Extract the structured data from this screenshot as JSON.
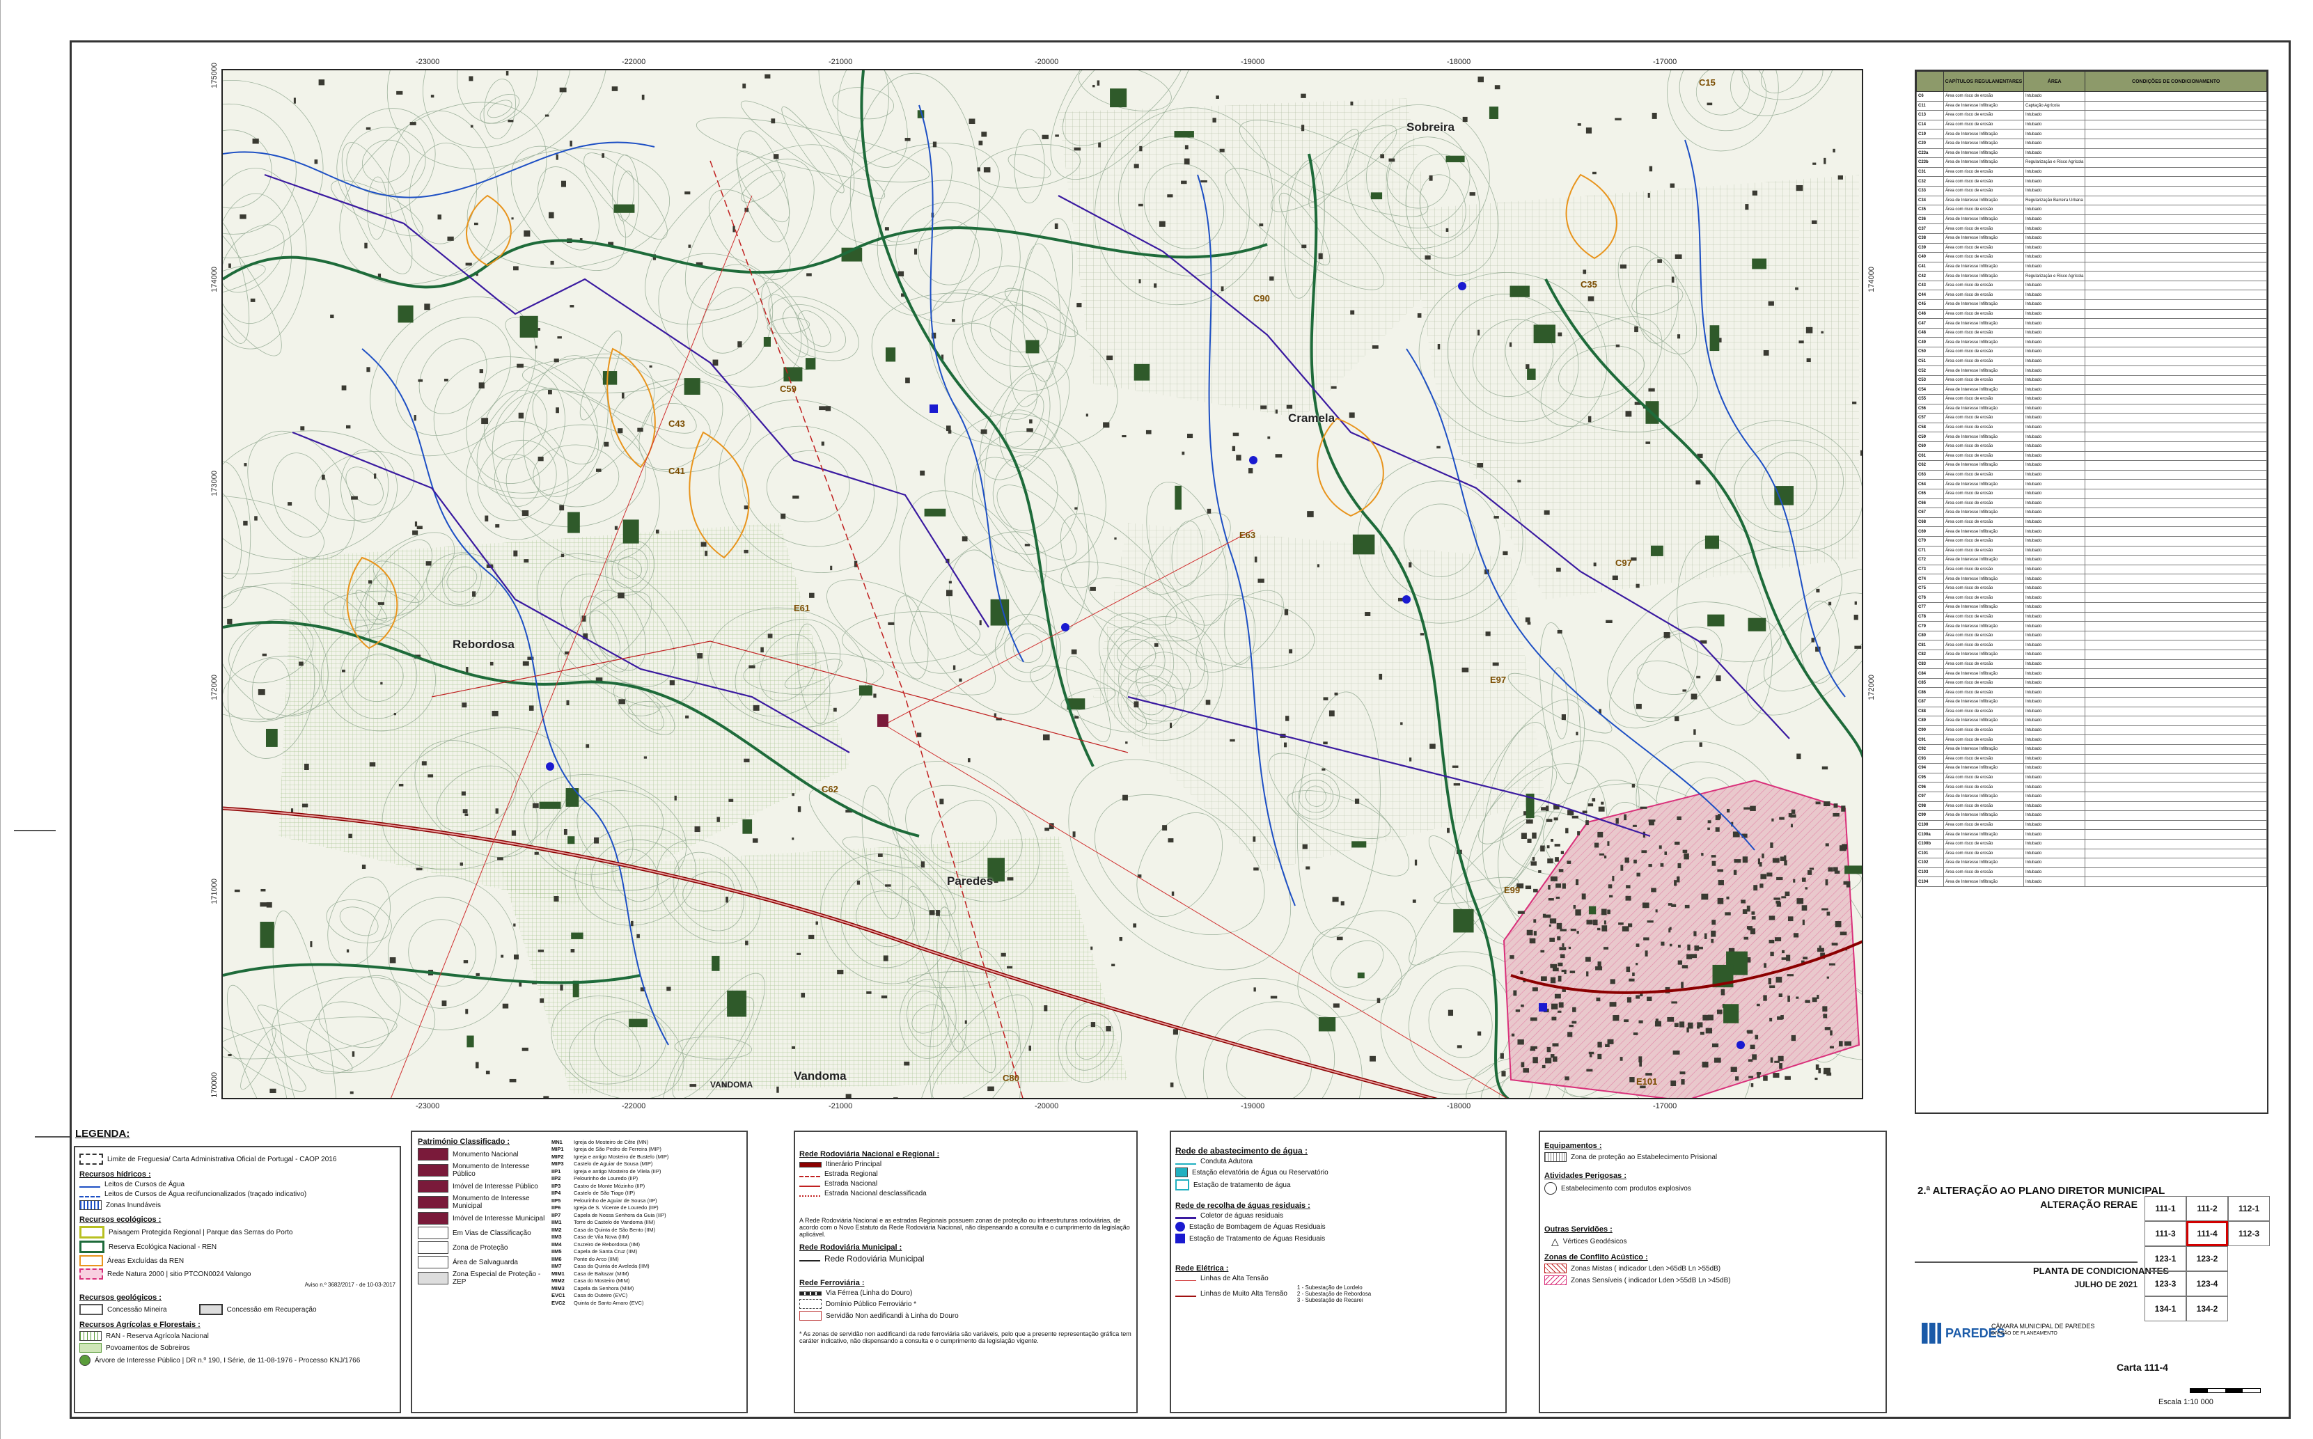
{
  "map": {
    "x_coords": [
      "-23000",
      "-22000",
      "-21000",
      "-20000",
      "-19000",
      "-18000",
      "-17000"
    ],
    "y_coords": [
      "175000",
      "174000",
      "173000",
      "172000",
      "171000",
      "170000"
    ],
    "places": [
      "Sobreira",
      "Cramela",
      "Rebordosa",
      "Paredes",
      "Vandoma"
    ],
    "features": [
      "VANDOMA",
      "C62",
      "C43",
      "C41",
      "C59",
      "E61",
      "E63",
      "E97",
      "E99",
      "E101",
      "C80",
      "C15",
      "C90",
      "C97",
      "C35"
    ]
  },
  "table": {
    "headers": [
      "",
      "CAPÍTULOS REGULAMENTARES",
      "ÁREA",
      "",
      "CONDIÇÕES DE CONDICIONAMENTO"
    ],
    "rows": [
      [
        "C6",
        "Área com risco de erosão",
        "Intubado"
      ],
      [
        "C11",
        "Área de Interesse Infiltração",
        "Captação Agrícola"
      ],
      [
        "C13",
        "Área com risco de erosão",
        "Intubado"
      ],
      [
        "C14",
        "Área com risco de erosão",
        "Intubado"
      ],
      [
        "C19",
        "Área de Interesse Infiltração",
        "Intubado"
      ],
      [
        "C20",
        "Área de Interesse Infiltração",
        "Intubado"
      ],
      [
        "C23a",
        "Área de Interesse Infiltração",
        "Intubado"
      ],
      [
        "C23b",
        "Área de Interesse Infiltração",
        "Regularização e Risco Agrícola"
      ],
      [
        "C31",
        "Área com risco de erosão",
        "Intubado"
      ],
      [
        "C32",
        "Área com risco de erosão",
        "Intubado"
      ],
      [
        "C33",
        "Área com risco de erosão",
        "Intubado"
      ],
      [
        "C34",
        "Área de Interesse Infiltração",
        "Regularização Barreira Urbana"
      ],
      [
        "C35",
        "Área com risco de erosão",
        "Intubado"
      ],
      [
        "C36",
        "Área de Interesse Infiltração",
        "Intubado"
      ],
      [
        "C37",
        "Área com risco de erosão",
        "Intubado"
      ],
      [
        "C38",
        "Área de Interesse Infiltração",
        "Intubado"
      ],
      [
        "C39",
        "Área com risco de erosão",
        "Intubado"
      ],
      [
        "C40",
        "Área com risco de erosão",
        "Intubado"
      ],
      [
        "C41",
        "Área de Interesse Infiltração",
        "Intubado"
      ],
      [
        "C42",
        "Área de Interesse Infiltração",
        "Regularização e Risco Agrícola"
      ],
      [
        "C43",
        "Área com risco de erosão",
        "Intubado"
      ],
      [
        "C44",
        "Área com risco de erosão",
        "Intubado"
      ],
      [
        "C45",
        "Área de Interesse Infiltração",
        "Intubado"
      ],
      [
        "C46",
        "Área com risco de erosão",
        "Intubado"
      ],
      [
        "C47",
        "Área de Interesse Infiltração",
        "Intubado"
      ],
      [
        "C48",
        "Área com risco de erosão",
        "Intubado"
      ],
      [
        "C49",
        "Área de Interesse Infiltração",
        "Intubado"
      ],
      [
        "C50",
        "Área com risco de erosão",
        "Intubado"
      ],
      [
        "C51",
        "Área com risco de erosão",
        "Intubado"
      ],
      [
        "C52",
        "Área de Interesse Infiltração",
        "Intubado"
      ],
      [
        "C53",
        "Área com risco de erosão",
        "Intubado"
      ],
      [
        "C54",
        "Área de Interesse Infiltração",
        "Intubado"
      ],
      [
        "C55",
        "Área com risco de erosão",
        "Intubado"
      ],
      [
        "C56",
        "Área de Interesse Infiltração",
        "Intubado"
      ],
      [
        "C57",
        "Área com risco de erosão",
        "Intubado"
      ],
      [
        "C58",
        "Área com risco de erosão",
        "Intubado"
      ],
      [
        "C59",
        "Área de Interesse Infiltração",
        "Intubado"
      ],
      [
        "C60",
        "Área com risco de erosão",
        "Intubado"
      ],
      [
        "C61",
        "Área com risco de erosão",
        "Intubado"
      ],
      [
        "C62",
        "Área de Interesse Infiltração",
        "Intubado"
      ],
      [
        "C63",
        "Área com risco de erosão",
        "Intubado"
      ],
      [
        "C64",
        "Área de Interesse Infiltração",
        "Intubado"
      ],
      [
        "C65",
        "Área com risco de erosão",
        "Intubado"
      ],
      [
        "C66",
        "Área com risco de erosão",
        "Intubado"
      ],
      [
        "C67",
        "Área de Interesse Infiltração",
        "Intubado"
      ],
      [
        "C68",
        "Área com risco de erosão",
        "Intubado"
      ],
      [
        "C69",
        "Área de Interesse Infiltração",
        "Intubado"
      ],
      [
        "C70",
        "Área com risco de erosão",
        "Intubado"
      ],
      [
        "C71",
        "Área com risco de erosão",
        "Intubado"
      ],
      [
        "C72",
        "Área de Interesse Infiltração",
        "Intubado"
      ],
      [
        "C73",
        "Área com risco de erosão",
        "Intubado"
      ],
      [
        "C74",
        "Área de Interesse Infiltração",
        "Intubado"
      ],
      [
        "C75",
        "Área com risco de erosão",
        "Intubado"
      ],
      [
        "C76",
        "Área com risco de erosão",
        "Intubado"
      ],
      [
        "C77",
        "Área de Interesse Infiltração",
        "Intubado"
      ],
      [
        "C78",
        "Área com risco de erosão",
        "Intubado"
      ],
      [
        "C79",
        "Área de Interesse Infiltração",
        "Intubado"
      ],
      [
        "C80",
        "Área com risco de erosão",
        "Intubado"
      ],
      [
        "C81",
        "Área com risco de erosão",
        "Intubado"
      ],
      [
        "C82",
        "Área de Interesse Infiltração",
        "Intubado"
      ],
      [
        "C83",
        "Área com risco de erosão",
        "Intubado"
      ],
      [
        "C84",
        "Área de Interesse Infiltração",
        "Intubado"
      ],
      [
        "C85",
        "Área com risco de erosão",
        "Intubado"
      ],
      [
        "C86",
        "Área com risco de erosão",
        "Intubado"
      ],
      [
        "C87",
        "Área de Interesse Infiltração",
        "Intubado"
      ],
      [
        "C88",
        "Área com risco de erosão",
        "Intubado"
      ],
      [
        "C89",
        "Área de Interesse Infiltração",
        "Intubado"
      ],
      [
        "C90",
        "Área com risco de erosão",
        "Intubado"
      ],
      [
        "C91",
        "Área com risco de erosão",
        "Intubado"
      ],
      [
        "C92",
        "Área de Interesse Infiltração",
        "Intubado"
      ],
      [
        "C93",
        "Área com risco de erosão",
        "Intubado"
      ],
      [
        "C94",
        "Área de Interesse Infiltração",
        "Intubado"
      ],
      [
        "C95",
        "Área com risco de erosão",
        "Intubado"
      ],
      [
        "C96",
        "Área com risco de erosão",
        "Intubado"
      ],
      [
        "C97",
        "Área de Interesse Infiltração",
        "Intubado"
      ],
      [
        "C98",
        "Área com risco de erosão",
        "Intubado"
      ],
      [
        "C99",
        "Área de Interesse Infiltração",
        "Intubado"
      ],
      [
        "C100",
        "Área com risco de erosão",
        "Intubado"
      ],
      [
        "C100a",
        "Área de Interesse Infiltração",
        "Intubado"
      ],
      [
        "C100b",
        "Área com risco de erosão",
        "Intubado"
      ],
      [
        "C101",
        "Área com risco de erosão",
        "Intubado"
      ],
      [
        "C102",
        "Área de Interesse Infiltração",
        "Intubado"
      ],
      [
        "C103",
        "Área com risco de erosão",
        "Intubado"
      ],
      [
        "C104",
        "Área de Interesse Infiltração",
        "Intubado"
      ]
    ]
  },
  "legend": {
    "title": "LEGENDA:",
    "limite": "Limite de Freguesia/ Carta Administrativa Oficial de Portugal - CAOP 2016",
    "hidricos": {
      "title": "Recursos hídricos :",
      "items": [
        "Leitos de Cursos de Água",
        "Leitos de Cursos de Água recifuncionalizados (traçado indicativo)",
        "Zonas Inundáveis"
      ]
    },
    "ecologicos": {
      "title": "Recursos ecológicos :",
      "items": [
        "Paisagem Protegida Regional | Parque das Serras do Porto",
        "Reserva Ecológica Nacional - REN",
        "Áreas Excluídas da REN",
        "Rede Natura 2000 | sitio PTCON0024 Valongo"
      ]
    },
    "aviso": "Aviso n.º 3682/2017 - de 10-03-2017",
    "geologicos": {
      "title": "Recursos geológicos :",
      "items": [
        "Concessão Mineira",
        "Concessão em Recuperação"
      ]
    },
    "agricolas": {
      "title": "Recursos Agrícolas e Florestais :",
      "items": [
        "RAN - Reserva Agrícola Nacional",
        "Povoamentos de Sobreiros",
        "Árvore de Interesse Público | DR n.º 190, I Série, de 11-08-1976 - Processo KNJ/1766"
      ]
    },
    "patrimonio": {
      "title": "Património Classificado :",
      "items": [
        "Monumento Nacional",
        "Monumento de Interesse Público",
        "Imóvel de Interesse Público",
        "Monumento de Interesse Municipal",
        "Imóvel de Interesse Municipal",
        "Em Vias de Classificação",
        "Zona de Proteção",
        "Área de Salvaguarda",
        "Zona Especial de Proteção - ZEP"
      ],
      "codes": [
        "MN1",
        "MIP1",
        "MIP2",
        "MIP3",
        "IIP1",
        "IIP2",
        "IIP3",
        "IIP4",
        "IIP5",
        "IIP6",
        "IIP7",
        "IIM1",
        "IIM2",
        "IIM3",
        "IIM4",
        "IIM5",
        "IIM6",
        "IIM7",
        "MIM1",
        "MIM2",
        "MIM3",
        "EVC1",
        "EVC2"
      ],
      "names": [
        "Igreja do Mosteiro de Cête (MN)",
        "Igreja de São Pedro de Ferreira (MIP)",
        "Igreja e antigo Mosteiro de Bustelo (MIP)",
        "Castelo de Aguiar de Sousa (MIP)",
        "Igreja e antigo Mosteiro de Vilela (IIP)",
        "Pelourinho de Louredo (IIP)",
        "Castro de Monte Mózinho (IIP)",
        "Castelo de São Tiago (IIP)",
        "Pelourinho de Aguiar de Sousa (IIP)",
        "Igreja de S. Vicente de Louredo (IIP)",
        "Capela de Nossa Senhora da Guia (IIP)",
        "Torre do Castelo de Vandoma (IIM)",
        "Casa da Quinta de São Bento (IIM)",
        "Casa de Vila Nova (IIM)",
        "Cruzeiro de Rebordosa (IIM)",
        "Capela de Santa Cruz (IIM)",
        "Ponte do Arco (IIM)",
        "Casa da Quinta de Aveleda (IIM)",
        "Casa de Baltazar (MIM)",
        "Casa do Mosteiro (MIM)",
        "Capela da Senhora (MIM)",
        "Casa do Outeiro (EVC)",
        "Quinta de Santo Amaro (EVC)"
      ]
    },
    "rodoviaria": {
      "title": "Rede Rodoviária Nacional e Regional :",
      "items": [
        "Itinerário Principal",
        "Estrada Regional",
        "Estrada Nacional",
        "Estrada Nacional desclassificada"
      ],
      "note": "A Rede Rodoviária Nacional e as estradas Regionais possuem zonas de proteção ou infraestruturas rodoviárias, de acordo com o Novo Estatuto da Rede Rodoviária Nacional, não dispensando a consulta e o cumprimento da legislação aplicável.",
      "municipal_title": "Rede Rodoviária Municipal :",
      "municipal_item": "Rede Rodoviária Municipal",
      "ferro_title": "Rede Ferroviária :",
      "ferro_items": [
        "Via Férrea (Linha do Douro)",
        "Domínio Público Ferroviário *",
        "Servidão Non aedificandi à Linha do Douro"
      ],
      "ferro_note": "* As zonas de servidão non aedificandi da rede ferroviária são variáveis, pelo que a presente representação gráfica tem caráter indicativo, não dispensando a consulta e o cumprimento da legislação vigente."
    },
    "agua": {
      "title": "Rede de abastecimento de água :",
      "items": [
        "Conduta Adutora",
        "Estação elevatória de Água ou Reservatório",
        "Estação de tratamento de água"
      ],
      "residuais_title": "Rede de recolha de águas residuais :",
      "residuais_items": [
        "Coletor de águas residuais",
        "Estação de Bombagem de Águas Residuais",
        "Estação de Tratamento de Águas Residuais"
      ],
      "eletrica_title": "Rede Elétrica :",
      "eletrica_items": [
        "Linhas de Alta Tensão",
        "Linhas de Muito Alta Tensão"
      ],
      "subestacoes": [
        "1 - Subestação de Lordelo",
        "2 - Subestação de Rebordosa",
        "3 - Subestação de Recarei"
      ]
    },
    "equipamentos": {
      "title": "Equipamentos :",
      "item": "Zona de proteção ao Estabelecimento Prisional",
      "perigosas_title": "Atividades Perigosas :",
      "perigosas_item": "Estabelecimento com produtos explosivos",
      "outras_title": "Outras Servidões :",
      "outras_item": "Vértices Geodésicos",
      "conflito_title": "Zonas de Conflito Acústico :",
      "conflito_items": [
        "Zonas Mistas ( indicador Lden >65dB Ln >55dB)",
        "Zonas Sensíveis ( indicador Lden >55dB Ln >45dB)"
      ]
    }
  },
  "title_block": {
    "plan": "2.ª ALTERAÇÃO AO PLANO DIRETOR MUNICIPAL",
    "type": "ALTERAÇÃO RERAE",
    "sheet_name": "PLANTA DE CONDICIONANTES",
    "date": "JULHO DE 2021",
    "municipality": "CÂMARA MUNICIPAL DE PAREDES",
    "division": "DIVISÃO DE PLANEAMENTO",
    "brand": "PAREDES",
    "carta": "Carta 111-4",
    "scale": "Escala 1:10 000",
    "grid": [
      "111-1",
      "111-2",
      "111-3",
      "111-4",
      "112-1",
      "112-3",
      "123-1",
      "123-2",
      "123-3",
      "123-4",
      "134-1",
      "134-2"
    ]
  },
  "colors": {
    "river": "#1d4fc4",
    "ren": "#1e6b3a",
    "ran": "#5a9c3a",
    "road": "#8b0000",
    "zone_orange": "#e8941c",
    "urban": "#e8a0b0",
    "patrimonio": "#7a1a3a",
    "table_header": "#8d9a6a"
  }
}
